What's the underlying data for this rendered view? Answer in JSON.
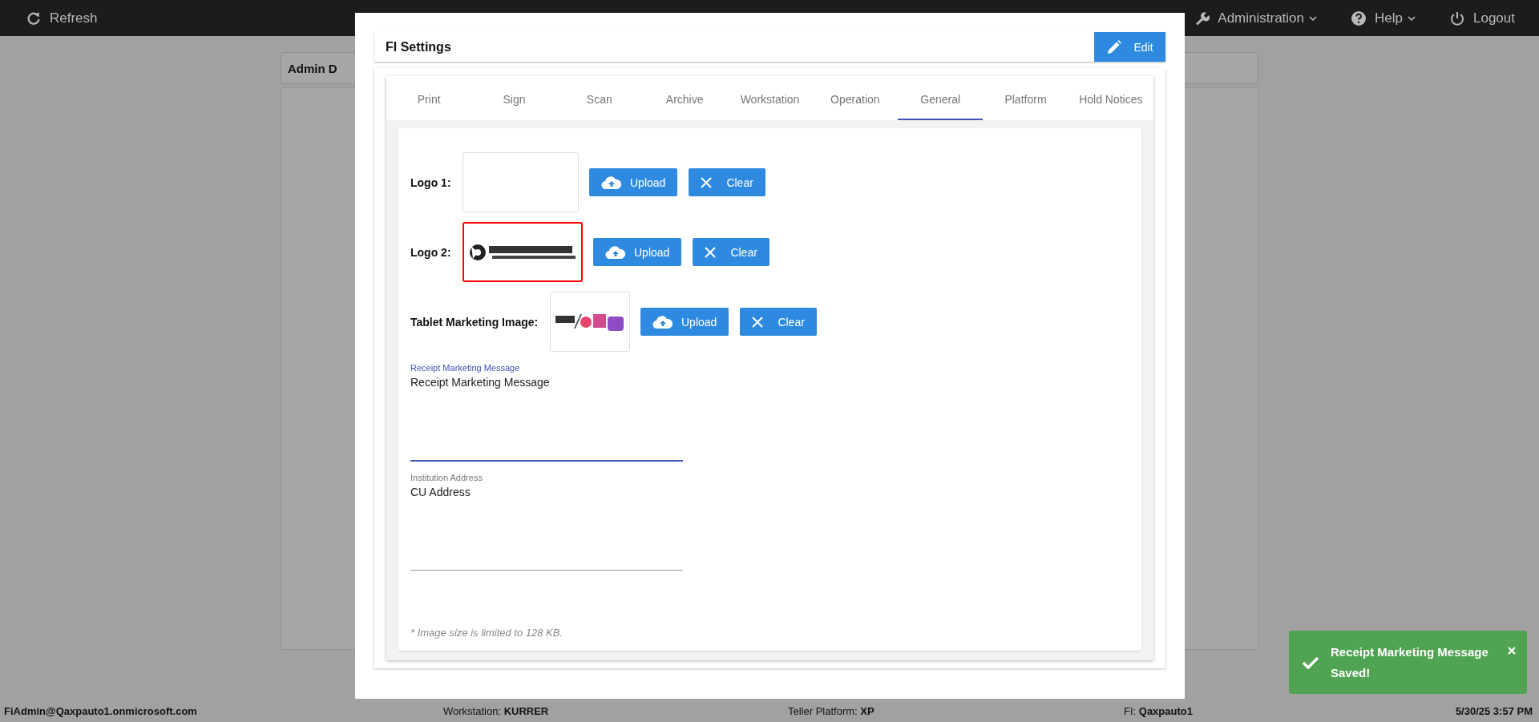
{
  "top_bar": {
    "refresh": "Refresh",
    "menus": [
      {
        "label": "Administration",
        "kind": "wrench",
        "dropdown": true
      },
      {
        "label": "Help",
        "kind": "help",
        "dropdown": true
      },
      {
        "label": "Logout",
        "kind": "power",
        "dropdown": false
      }
    ]
  },
  "background_panel": {
    "title": "Admin D"
  },
  "dialog": {
    "title": "FI Settings",
    "edit_button": "Edit",
    "tabs": [
      {
        "label": "Print",
        "selected": false
      },
      {
        "label": "Sign",
        "selected": false
      },
      {
        "label": "Scan",
        "selected": false
      },
      {
        "label": "Archive",
        "selected": false
      },
      {
        "label": "Workstation",
        "selected": false
      },
      {
        "label": "Operation",
        "selected": false
      },
      {
        "label": "General",
        "selected": true
      },
      {
        "label": "Platform",
        "selected": false
      },
      {
        "label": "Hold Notices",
        "selected": false
      }
    ],
    "image_rows": [
      {
        "label": "Logo 1:",
        "highlighted": false,
        "upload": "Upload",
        "clear": "Clear"
      },
      {
        "label": "Logo 2:",
        "highlighted": true,
        "upload": "Upload",
        "clear": "Clear"
      },
      {
        "label": "Tablet Marketing Image:",
        "highlighted": false,
        "upload": "Upload",
        "clear": "Clear"
      }
    ],
    "fields": [
      {
        "label": "Receipt Marketing Message",
        "value": "Receipt Marketing Message",
        "focused": true
      },
      {
        "label": "Institution Address",
        "value": "CU Address",
        "focused": false
      }
    ],
    "note": "* Image size is limited to 128 KB."
  },
  "status_bar": {
    "user": "FiAdmin@Qaxpauto1.onmicrosoft.com",
    "items": [
      "Workstation: **KURRER**",
      "Teller Platform: **XP**",
      "FI: **Qaxpauto1**"
    ],
    "datetime": "5/30/25 3:57 PM"
  },
  "toast": {
    "message": "Receipt Marketing Message Saved!"
  }
}
